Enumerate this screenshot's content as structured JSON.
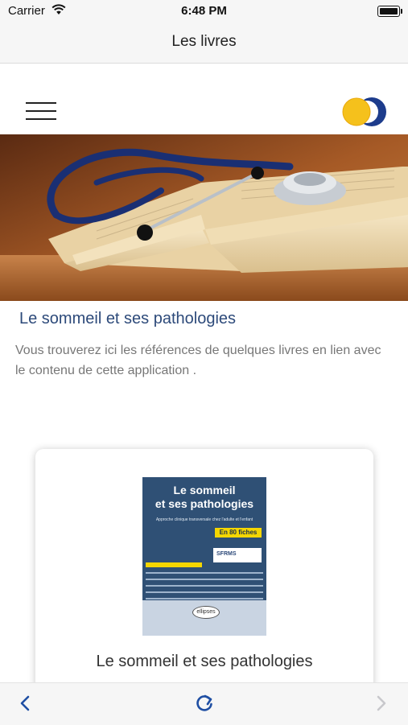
{
  "status_bar": {
    "carrier": "Carrier",
    "time": "6:48 PM"
  },
  "nav": {
    "title": "Les livres"
  },
  "header": {
    "menu_icon": "hamburger-menu-icon",
    "logo": "sfrms-logo"
  },
  "hero": {
    "image": "stethoscope-on-open-book-photo"
  },
  "article": {
    "title": "Le sommeil et ses pathologies",
    "description": " Vous trouverez ici les références de quelques livres en lien avec le contenu de cette application ."
  },
  "book_card": {
    "cover": {
      "title_line1": "Le sommeil",
      "title_line2": "et ses pathologies",
      "subtitle": "Approche clinique transversale chez l'adulte et l'enfant",
      "badge": "En 80 fiches",
      "society": "SFRMS",
      "publisher": "ellipses"
    },
    "title": "Le sommeil et ses pathologies"
  },
  "toolbar": {
    "back_icon": "chevron-left-icon",
    "reload_icon": "reload-icon",
    "forward_icon": "chevron-right-icon"
  },
  "colors": {
    "accent_blue": "#1f4fa3",
    "title_blue": "#2d4a7a",
    "logo_yellow": "#f5c11c",
    "logo_navy": "#1d3c8c"
  }
}
